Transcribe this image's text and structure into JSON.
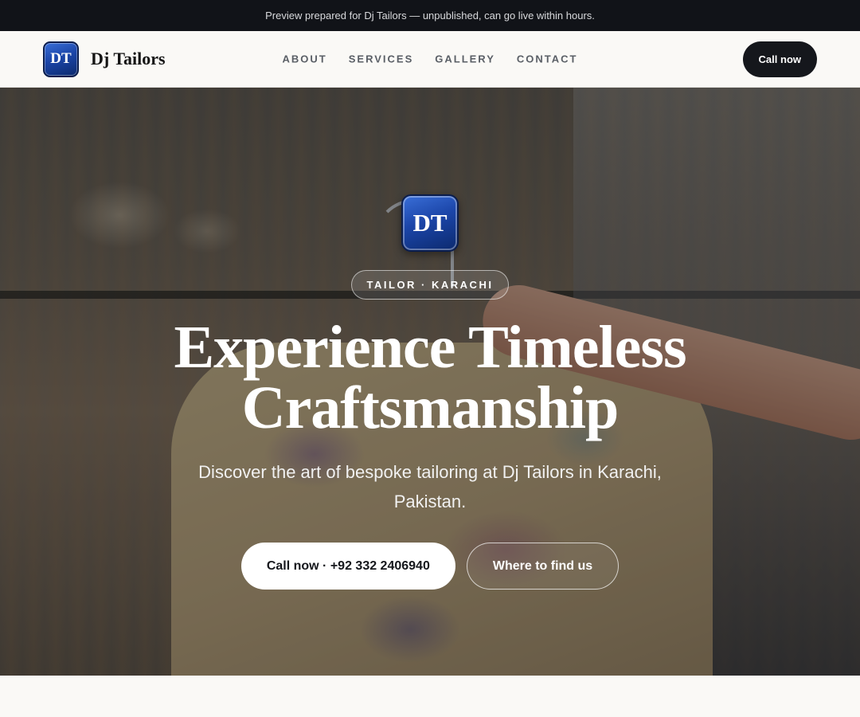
{
  "topbar": {
    "text": "Preview prepared for Dj Tailors — unpublished, can go live within hours."
  },
  "nav": {
    "logo_text": "DT",
    "brand_name": "Dj Tailors",
    "links": [
      "ABOUT",
      "SERVICES",
      "GALLERY",
      "CONTACT"
    ],
    "cta_label": "Call now"
  },
  "hero": {
    "logo_text": "DT",
    "badge": "TAILOR · KARACHI",
    "headline": "Experience Timeless Craftsmanship",
    "subtitle": "Discover the art of bespoke tailoring at Dj Tailors in Karachi, Pakistan.",
    "primary_cta": "Call now · +92 332 2406940",
    "secondary_cta": "Where to find us"
  },
  "colors": {
    "topbar_bg": "#111318",
    "page_bg": "#faf9f6",
    "dark_button": "#15171c",
    "logo_blue": "#1b45a8"
  }
}
